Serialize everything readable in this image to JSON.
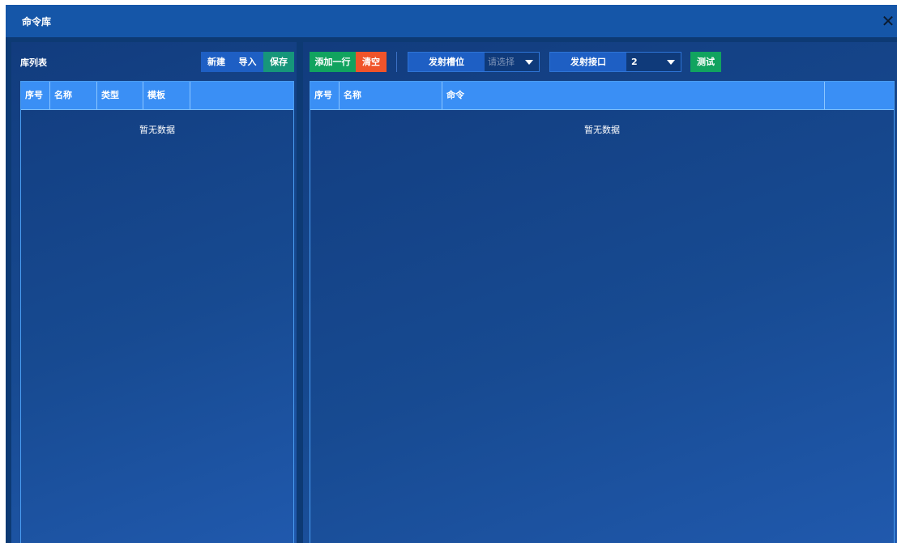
{
  "window": {
    "title": "命令库"
  },
  "left_panel": {
    "title": "库列表",
    "buttons": {
      "new": "新建",
      "import": "导入",
      "save": "保存"
    },
    "table": {
      "columns": [
        "序号",
        "名称",
        "类型",
        "模板",
        ""
      ],
      "empty_text": "暂无数据"
    }
  },
  "right_panel": {
    "buttons": {
      "add_row": "添加一行",
      "clear": "清空",
      "test": "测试"
    },
    "slot_select": {
      "label": "发射槽位",
      "placeholder": "请选择"
    },
    "port_select": {
      "label": "发射接口",
      "value": "2"
    },
    "table": {
      "columns": [
        "序号",
        "名称",
        "命令",
        ""
      ],
      "empty_text": "暂无数据"
    }
  }
}
